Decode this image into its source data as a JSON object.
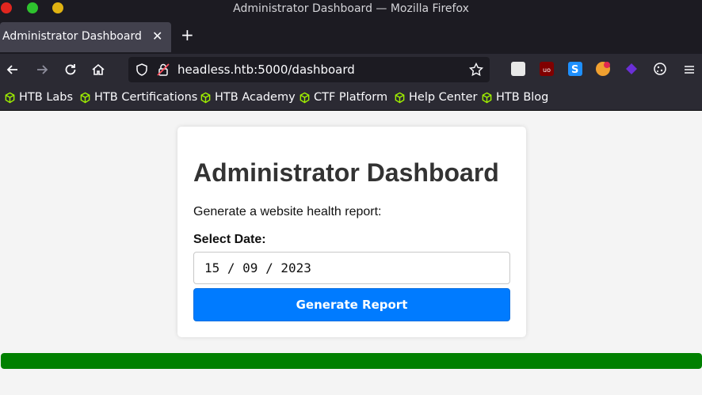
{
  "window": {
    "title": "Administrator Dashboard — Mozilla Firefox"
  },
  "tab": {
    "title": "Administrator Dashboard",
    "close": "✕",
    "new_tab": "+"
  },
  "urlbar": {
    "url": "headless.htb:5000/dashboard"
  },
  "bookmarks": [
    {
      "label": "HTB Labs"
    },
    {
      "label": "HTB Certifications"
    },
    {
      "label": "HTB Academy"
    },
    {
      "label": "CTF Platform"
    },
    {
      "label": "Help Center"
    },
    {
      "label": "HTB Blog"
    }
  ],
  "card": {
    "heading": "Administrator Dashboard",
    "description": "Generate a website health report:",
    "date_label": "Select Date:",
    "date_value": "15 / 09 / 2023",
    "button_label": "Generate Report"
  },
  "progress": {
    "fraction": 1.0,
    "color": "#008000"
  },
  "colors": {
    "accent": "#007bff",
    "bookmark_icon": "#9fef00"
  }
}
